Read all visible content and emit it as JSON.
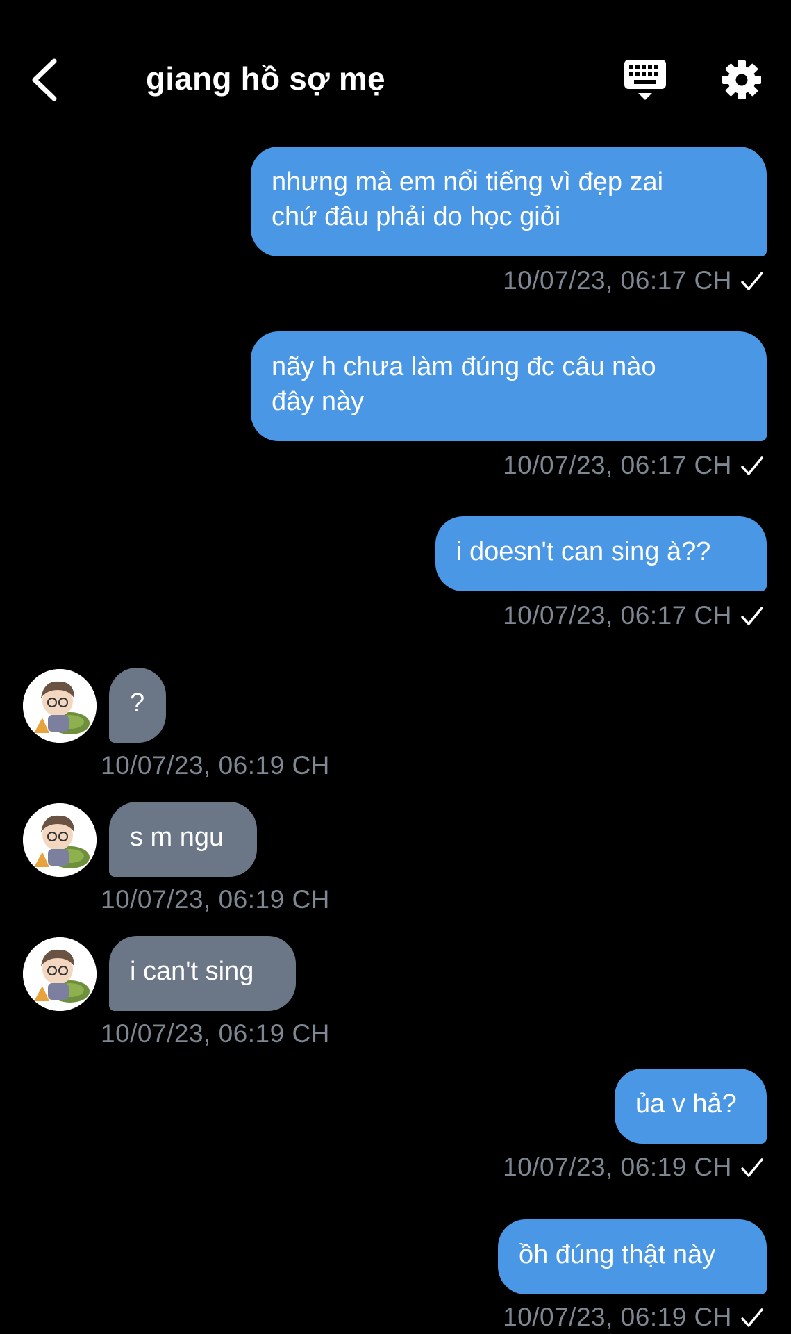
{
  "header": {
    "title": "giang hồ sợ mẹ",
    "back_icon": "chevron-left-icon",
    "keyboard_icon": "keyboard-icon",
    "settings_icon": "gear-icon"
  },
  "colors": {
    "background": "#000000",
    "outgoing_bubble": "#4a97e6",
    "incoming_bubble": "#6b7686",
    "timestamp": "#7f8792"
  },
  "messages": [
    {
      "direction": "out",
      "text": "nhưng mà em nổi tiếng vì đẹp zai\nchứ đâu phải do học giỏi",
      "time": "10/07/23, 06:17 CH",
      "status_icon": "check-icon"
    },
    {
      "direction": "out",
      "text": "nãy h chưa làm đúng đc câu nào\nđây này",
      "time": "10/07/23, 06:17 CH",
      "status_icon": "check-icon"
    },
    {
      "direction": "out",
      "text": "i doesn't can sing à??",
      "time": "10/07/23, 06:17 CH",
      "status_icon": "check-icon"
    },
    {
      "direction": "in",
      "text": "?",
      "time": "10/07/23, 06:19 CH",
      "avatar_icon": "avatar-icon"
    },
    {
      "direction": "in",
      "text": "s m ngu",
      "time": "10/07/23, 06:19 CH",
      "avatar_icon": "avatar-icon"
    },
    {
      "direction": "in",
      "text": "i can't sing",
      "time": "10/07/23, 06:19 CH",
      "avatar_icon": "avatar-icon"
    },
    {
      "direction": "out",
      "text": "ủa v hả?",
      "time": "10/07/23, 06:19 CH",
      "status_icon": "check-icon"
    },
    {
      "direction": "out",
      "text": "ồh đúng thật này",
      "time": "10/07/23, 06:19 CH",
      "status_icon": "check-icon"
    }
  ]
}
